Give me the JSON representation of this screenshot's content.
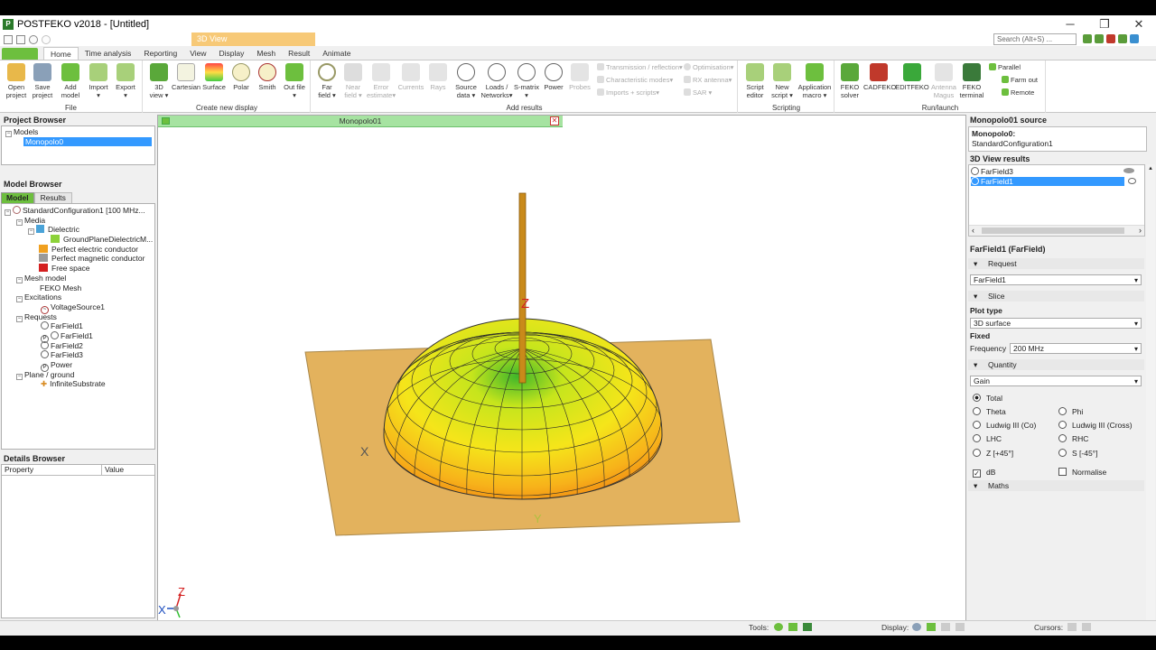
{
  "app": {
    "title": "POSTFEKO v2018 - [Untitled]",
    "context_tab": "3D View",
    "search_placeholder": "Search (Alt+S) ..."
  },
  "tabs": [
    "Home",
    "Time analysis",
    "Reporting",
    "View",
    "Display",
    "Mesh",
    "Result",
    "Animate"
  ],
  "ribbon": {
    "file": {
      "label": "File",
      "buttons": [
        {
          "l1": "Open",
          "l2": "project"
        },
        {
          "l1": "Save",
          "l2": "project"
        },
        {
          "l1": "Add",
          "l2": "model"
        },
        {
          "l1": "Import",
          "l2": "▾"
        },
        {
          "l1": "Export",
          "l2": "▾"
        }
      ]
    },
    "display": {
      "label": "Create new display",
      "buttons": [
        {
          "l1": "3D",
          "l2": "view ▾"
        },
        {
          "l1": "Cartesian",
          "l2": ""
        },
        {
          "l1": "Surface",
          "l2": ""
        },
        {
          "l1": "Polar",
          "l2": ""
        },
        {
          "l1": "Smith",
          "l2": ""
        },
        {
          "l1": "Out file",
          "l2": "▾"
        }
      ]
    },
    "results": {
      "label": "Add results",
      "buttons": [
        {
          "l1": "Far",
          "l2": "field ▾"
        },
        {
          "l1": "Near",
          "l2": "field ▾"
        },
        {
          "l1": "Error",
          "l2": "estimate▾"
        },
        {
          "l1": "Currents",
          "l2": ""
        },
        {
          "l1": "Rays",
          "l2": ""
        },
        {
          "l1": "Source",
          "l2": "data ▾"
        },
        {
          "l1": "Loads /",
          "l2": "Networks▾"
        },
        {
          "l1": "S-matrix",
          "l2": "▾"
        },
        {
          "l1": "Power",
          "l2": ""
        },
        {
          "l1": "Probes",
          "l2": ""
        }
      ],
      "small": [
        "Transmission / reflection▾",
        "Characteristic modes▾",
        "Imports + scripts▾",
        "Optimisation▾",
        "RX antenna▾",
        "SAR ▾"
      ]
    },
    "scripting": {
      "label": "Scripting",
      "buttons": [
        {
          "l1": "Script",
          "l2": "editor"
        },
        {
          "l1": "New",
          "l2": "script ▾"
        },
        {
          "l1": "Application",
          "l2": "macro ▾"
        }
      ]
    },
    "run": {
      "label": "Run/launch",
      "buttons": [
        {
          "l1": "FEKO",
          "l2": "solver"
        },
        {
          "l1": "CADFEKO",
          "l2": ""
        },
        {
          "l1": "EDITFEKO",
          "l2": ""
        },
        {
          "l1": "Antenna",
          "l2": "Magus"
        },
        {
          "l1": "FEKO",
          "l2": "terminal"
        }
      ],
      "small": [
        "Parallel",
        "Farm out",
        "Remote"
      ]
    }
  },
  "project_browser": {
    "title": "Project Browser",
    "models_label": "Models",
    "selected_model": "Monopolo0"
  },
  "model_browser": {
    "title": "Model Browser",
    "tabs": [
      "Model",
      "Results"
    ],
    "tree": {
      "root": "StandardConfiguration1 [100 MHz...",
      "media": "Media",
      "dielectric": "Dielectric",
      "ground_diel": "GroundPlaneDielectricM...",
      "pec": "Perfect electric conductor",
      "pmc": "Perfect magnetic conductor",
      "free": "Free space",
      "mesh_model": "Mesh model",
      "feko_mesh": "FEKO Mesh",
      "excitations": "Excitations",
      "vsource": "VoltageSource1",
      "requests": "Requests",
      "ff1": "FarField1",
      "ff1b": "FarField1",
      "ff2": "FarField2",
      "ff3": "FarField3",
      "power": "Power",
      "plane": "Plane / ground",
      "substrate": "InfiniteSubstrate"
    }
  },
  "details_browser": {
    "title": "Details Browser",
    "col_property": "Property",
    "col_value": "Value"
  },
  "viewport": {
    "tab_label": "Monopolo01",
    "axis_z": "Z",
    "axis_x": "X",
    "axis_y": "Y"
  },
  "right": {
    "source_title": "Monopolo01 source",
    "source_line1": "Monopolo0:",
    "source_line2": "StandardConfiguration1",
    "results_title": "3D View results",
    "result_items": [
      "FarField3",
      "FarField1"
    ],
    "props_title": "FarField1 (FarField)",
    "request_label": "Request",
    "request_value": "FarField1",
    "slice_label": "Slice",
    "plot_type_label": "Plot type",
    "plot_type_value": "3D surface",
    "fixed_label": "Fixed",
    "frequency_label": "Frequency",
    "frequency_value": "200 MHz",
    "quantity_label": "Quantity",
    "quantity_value": "Gain",
    "radios": [
      "Total",
      "Theta",
      "Phi",
      "Ludwig III (Co)",
      "Ludwig III (Cross)",
      "LHC",
      "RHC",
      "Z [+45°]",
      "S [-45°]"
    ],
    "db_label": "dB",
    "normalise_label": "Normalise",
    "maths_label": "Maths"
  },
  "status": {
    "tools": "Tools:",
    "display": "Display:",
    "cursors": "Cursors:"
  }
}
